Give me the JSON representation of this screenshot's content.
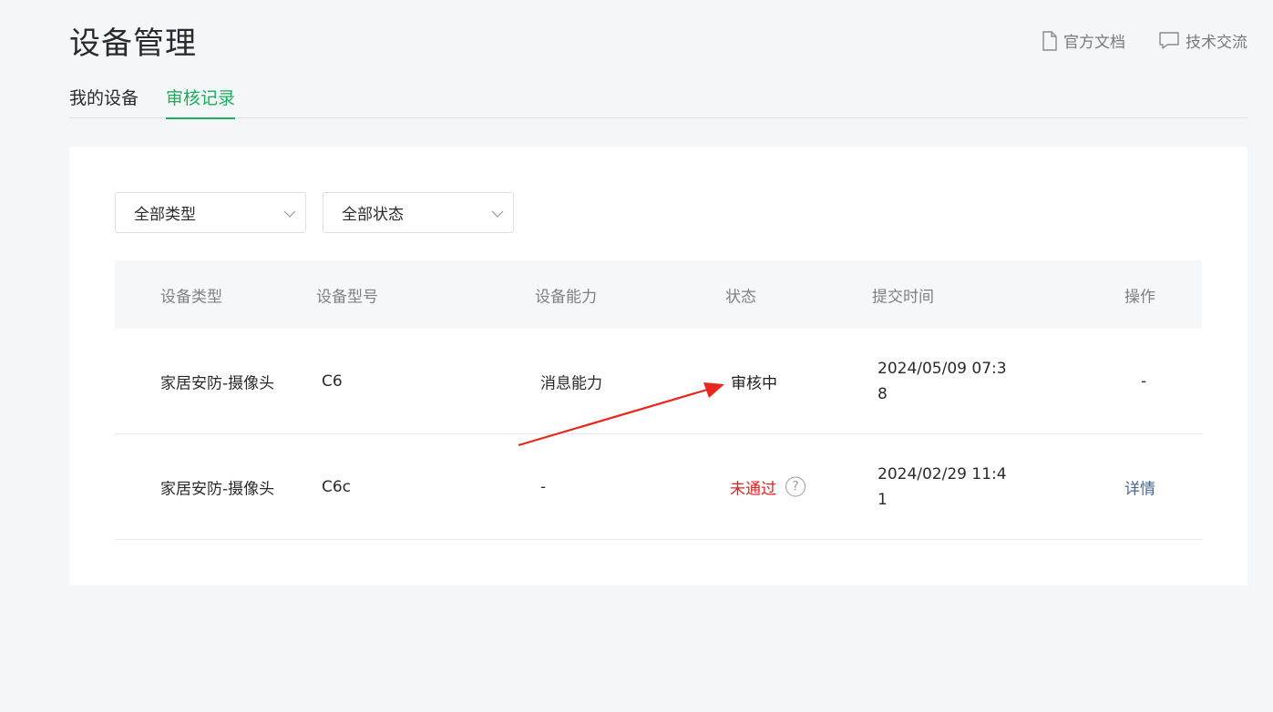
{
  "header": {
    "title": "设备管理",
    "links": [
      {
        "label": "官方文档",
        "icon": "document-icon"
      },
      {
        "label": "技术交流",
        "icon": "chat-icon"
      }
    ]
  },
  "tabs": [
    {
      "label": "我的设备",
      "active": false
    },
    {
      "label": "审核记录",
      "active": true
    }
  ],
  "filters": {
    "type": {
      "value": "全部类型"
    },
    "status": {
      "value": "全部状态"
    }
  },
  "table": {
    "headers": [
      "设备类型",
      "设备型号",
      "设备能力",
      "状态",
      "提交时间",
      "操作"
    ],
    "rows": [
      {
        "type": "家居安防-摄像头",
        "model": "C6",
        "capability": "消息能力",
        "status": "审核中",
        "submitted": "2024/05/09 07:38",
        "action": "-"
      },
      {
        "type": "家居安防-摄像头",
        "model": "C6c",
        "capability": "-",
        "status": "未通过",
        "help": "?",
        "submitted": "2024/02/29 11:41",
        "action": "详情"
      }
    ]
  },
  "colors": {
    "accent": "#1aad5b",
    "rejected": "#e02020",
    "link": "#4a6590",
    "annotation_arrow": "#e8281e"
  }
}
